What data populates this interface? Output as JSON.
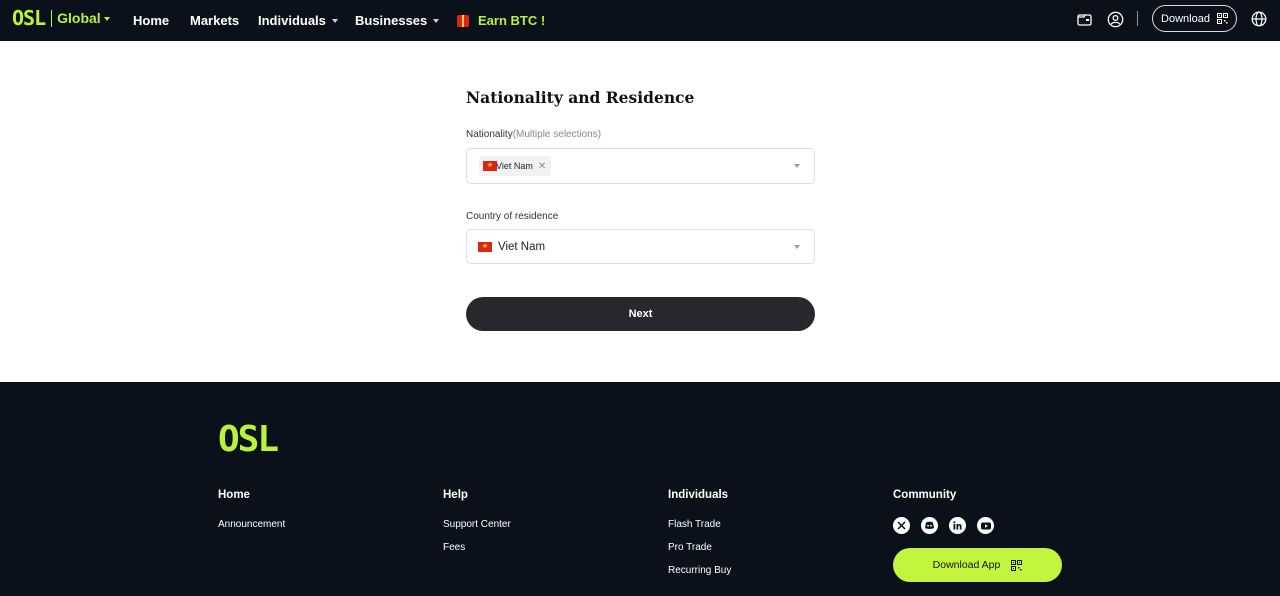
{
  "header": {
    "logo": "OSL",
    "region": "Global",
    "nav": {
      "home": "Home",
      "markets": "Markets",
      "individuals": "Individuals",
      "businesses": "Businesses",
      "earn": "Earn BTC !"
    },
    "download_label": "Download"
  },
  "form": {
    "title": "Nationality and Residence",
    "nationality_label": "Nationality",
    "nationality_hint": "(Multiple selections)",
    "nationality_tags": [
      "Viet Nam"
    ],
    "residence_label": "Country of residence",
    "residence_value": "Viet Nam",
    "next_label": "Next"
  },
  "footer": {
    "logo": "OSL",
    "columns": [
      {
        "title": "Home",
        "links": [
          "Announcement"
        ]
      },
      {
        "title": "Help",
        "links": [
          "Support Center",
          "Fees"
        ]
      },
      {
        "title": "Individuals",
        "links": [
          "Flash Trade",
          "Pro Trade",
          "Recurring Buy"
        ]
      },
      {
        "title": "Community",
        "links": []
      }
    ],
    "social_icons": [
      "x-icon",
      "discord-icon",
      "linkedin-icon",
      "youtube-icon"
    ],
    "download_app_label": "Download App"
  },
  "colors": {
    "brand": "#b8f23a",
    "header_bg": "#0b111a",
    "button_dark": "#27282b",
    "download_app_bg": "#c4f53e"
  }
}
